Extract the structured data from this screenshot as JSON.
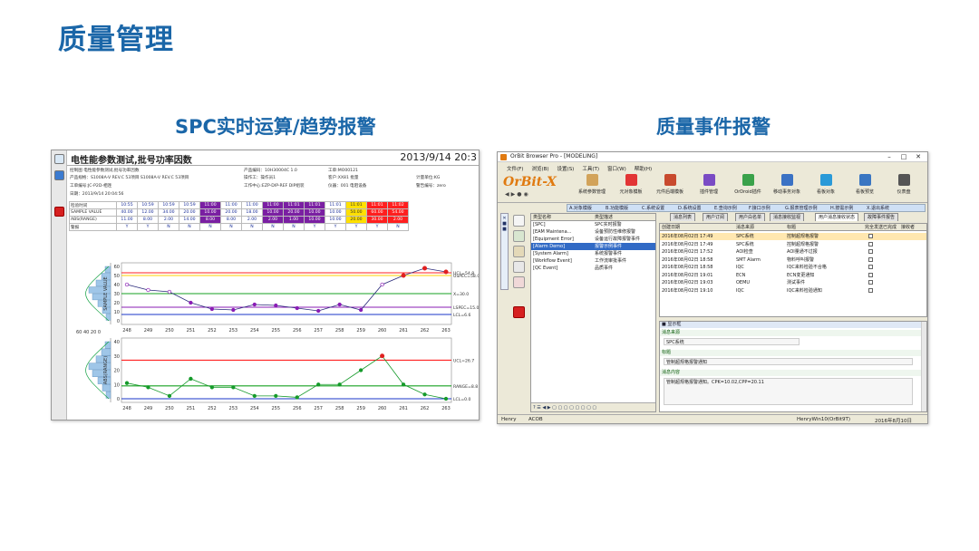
{
  "page_title": "质量管理",
  "left_caption": "SPC实时运算/趋势报警",
  "right_caption": "质量事件报警",
  "spc": {
    "title": "电性能参数测试,批号功率因数",
    "date": "2013/9/14 20:3",
    "info": [
      "控制图  电性能参数测试,批号功率因数",
      "产品规格：S1008A-V REV.C  53项目  S1008A-V REV.C  53项目",
      "工单编号:JC-P2D-相连",
      "日期：2013/9/14 20:04:56"
    ],
    "info_mid": [
      "产品编码：10H30004C 1.0",
      "操作工：操作员1",
      "工作中心:EZP-DIP-REF DIP组装"
    ],
    "info_right": [
      "工单:MO00121",
      "客户:XX81 批量",
      "仪器：001 电阻设备"
    ],
    "info_far": [
      "计量单位:KG",
      "警告编号：zero"
    ],
    "table_labels": [
      "检验时间",
      "SAMPLE VALUE",
      "ABS(RANGE)",
      "警报"
    ],
    "times": [
      "10:55",
      "10:59",
      "10:59",
      "10:59",
      "11:00",
      "11:00",
      "11:00",
      "11:00",
      "11:01",
      "11:01",
      "11:01",
      "11:01",
      "11:01",
      "11:02"
    ],
    "samples": [
      "40.00",
      "12.00",
      "34.00",
      "20.00",
      "10.00",
      "20.00",
      "18.00",
      "10.00",
      "20.00",
      "10.00",
      "10.00",
      "50.00",
      "60.00",
      "54.00"
    ],
    "ranges": [
      "11.00",
      "8.00",
      "2.00",
      "14.00",
      "8.00",
      "8.00",
      "2.00",
      "2.00",
      "1.00",
      "10.00",
      "10.00",
      "20.00",
      "30.00",
      "2.00"
    ],
    "alarms": [
      "Y",
      "Y",
      "N",
      "N",
      "N",
      "N",
      "N",
      "N",
      "N",
      "Y",
      "Y",
      "Y",
      "Y",
      "N"
    ],
    "cell_colors": [
      "#ffffff",
      "#ffffff",
      "#ffffff",
      "#ffffff",
      "#7a1fa2",
      "#ffffff",
      "#ffffff",
      "#7a1fa2",
      "#7a1fa2",
      "#7a1fa2",
      "#ffffff",
      "#ffe000",
      "#ff1e1e",
      "#ff1e1e"
    ],
    "chart_data": [
      {
        "type": "line",
        "x": [
          248,
          249,
          250,
          251,
          252,
          253,
          254,
          255,
          256,
          257,
          258,
          259,
          260,
          261,
          262,
          263
        ],
        "values": [
          40,
          34,
          32,
          20,
          13,
          12,
          18,
          17,
          14,
          11,
          18,
          12,
          40,
          50,
          58,
          54
        ],
        "ylabel": "SAMPLE VALUE",
        "ylim": [
          0,
          60
        ],
        "y_ticks": [
          0,
          10,
          20,
          30,
          40,
          50,
          60
        ],
        "limit_lines": [
          {
            "label": "UCL=54.8",
            "value": 53,
            "color": "#ff2020"
          },
          {
            "label": "USPEC=58.0",
            "value": 50,
            "color": "#ffd000"
          },
          {
            "label": "X=30.0",
            "value": 30,
            "color": "#16a020"
          },
          {
            "label": "LSPEC=15.0",
            "value": 15,
            "color": "#8a1cb5"
          },
          {
            "label": "LCL=6.6",
            "value": 7,
            "color": "#1a36c8"
          }
        ]
      },
      {
        "type": "line",
        "x": [
          248,
          249,
          250,
          251,
          252,
          253,
          254,
          255,
          256,
          257,
          258,
          259,
          260,
          261,
          262,
          263
        ],
        "values": [
          11,
          8,
          2,
          14,
          8,
          8,
          2,
          2,
          1,
          10,
          10,
          20,
          30,
          10,
          3,
          0
        ],
        "ylabel": "ABS(RANGE)",
        "ylim": [
          0,
          40
        ],
        "y_ticks": [
          0,
          10,
          20,
          30,
          40
        ],
        "limit_lines": [
          {
            "label": "UCL=26.7",
            "value": 27,
            "color": "#ff2020"
          },
          {
            "label": "RANGE=8.8",
            "value": 9,
            "color": "#16a020"
          },
          {
            "label": "LCL=0.0",
            "value": 0,
            "color": "#1a36c8"
          }
        ]
      }
    ],
    "hist_axis": "60 40 20 0"
  },
  "orbit": {
    "window_title": "OrBit Browser Pro - [MODELING]",
    "menu": [
      "文件(F)",
      "浏览(B)",
      "设置(S)",
      "工具(T)",
      "窗口(W)",
      "帮助(H)"
    ],
    "logo": "OrBit-X",
    "toolbar": [
      "系统参数管理",
      "元对象模板",
      "元件后端模板",
      "插件管理",
      "OrDroid插件",
      "移动事务对象",
      "看板对象",
      "看板预览",
      "仪表盘"
    ],
    "toolbar_colors": [
      "#d2a35a",
      "#e23535",
      "#c84a2e",
      "#7a4bc4",
      "#3aa24a",
      "#3b72c4",
      "#2a9ad8",
      "#3a76c2",
      "#555555"
    ],
    "modules": [
      "A.对象模版",
      "B.功能模版",
      "C.系统设置",
      "D.系统设置",
      "E.查询示例",
      "F.接口示例",
      "G.报表管理示例",
      "H.按需示例",
      "X.退出系统"
    ],
    "list_headers": [
      "类型名称",
      "类型描述"
    ],
    "list_rows": [
      [
        "[SPC]",
        "SPC实时报警"
      ],
      [
        "[EAM Maintena...",
        "设备预防性维修报警"
      ],
      [
        "[Equipment Error]",
        "设备运行故障报警事件"
      ],
      [
        "[Alarm Demo]",
        "报警示例事件"
      ],
      [
        "[System Alarm]",
        "系统报警事件"
      ],
      [
        "[Workflow Event]",
        "工作流审批事件"
      ],
      [
        "[QC Event]",
        "品质事件"
      ]
    ],
    "subtabs": [
      "消息列表",
      "用户订阅",
      "用户白名单",
      "消息接收监视",
      "用户消息接收状态",
      "故障事件报告"
    ],
    "grid_headers": [
      "创建日期",
      "消息来源",
      "标题",
      "完全发送已完成",
      "接收者"
    ],
    "grid_rows": [
      [
        "2016年08月02日 17:49",
        "SPC系统",
        "控制超规格报警"
      ],
      [
        "2016年08月02日 17:49",
        "SPC系统",
        "控制超规格报警"
      ],
      [
        "2016年08月02日 17:52",
        "AOI检查",
        "AOI量通不过报"
      ],
      [
        "2016年08月02日 18:58",
        "SMT Alarm",
        "物料呼叫报警"
      ],
      [
        "2016年08月02日 18:58",
        "IQC",
        "IQC来料检验不合格"
      ],
      [
        "2016年08月02日 19:01",
        "ECN",
        "ECN变更通知"
      ],
      [
        "2016年08月02日 19:03",
        "OEMU",
        "测试事件"
      ],
      [
        "2016年08月02日 19:10",
        "IQC",
        "IQC来料检验通知"
      ]
    ],
    "detail": {
      "section": "■ 显示框",
      "source_label": "消息来源",
      "source_value": "SPC系统",
      "title_label": "标题",
      "title_value": "管制超规格报警通知",
      "content_label": "消息内容",
      "content_value": "管制超规格报警通知。CPK=10.02,CPP=20.11"
    },
    "status": [
      "Henry",
      "ACOB",
      "HenryWin10(OrBit9T)",
      "2016年8月10日"
    ]
  }
}
